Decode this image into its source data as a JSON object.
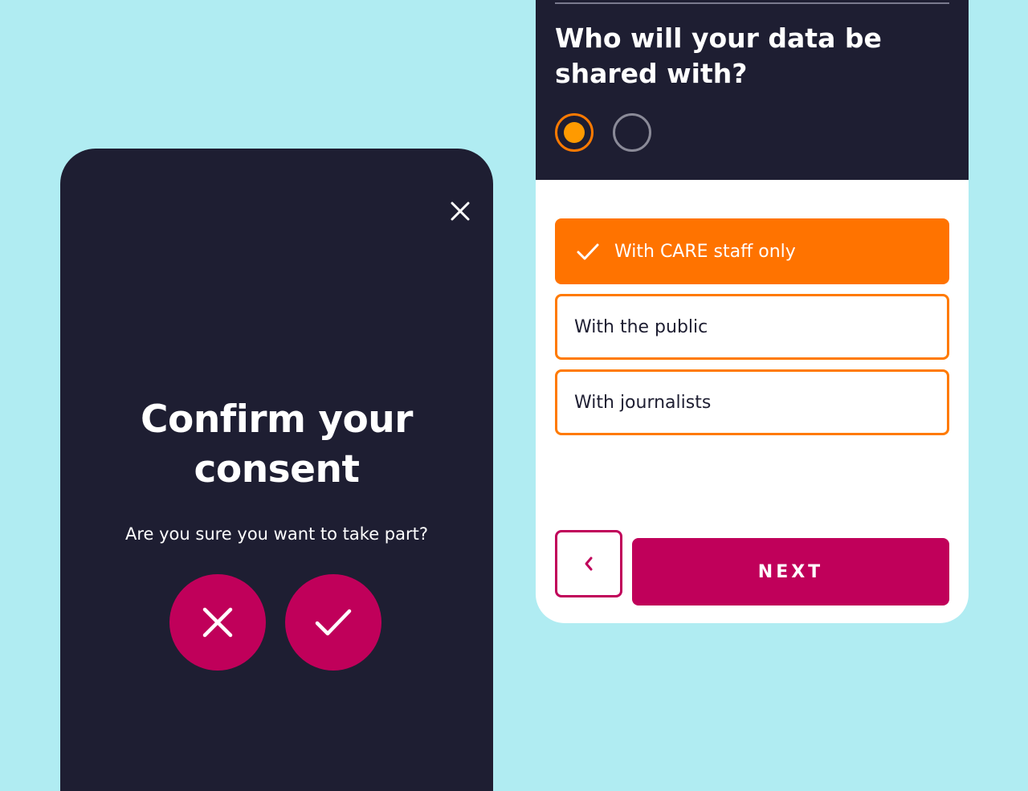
{
  "colors": {
    "background": "#b0ecf2",
    "panel_dark": "#1e1e32",
    "accent_orange": "#ff7300",
    "accent_magenta": "#c0005a"
  },
  "consent_modal": {
    "close_icon": "close-icon",
    "title": "Confirm your consent",
    "subtitle": "Are you sure you want to take part?",
    "decline_icon": "x-icon",
    "accept_icon": "checkmark-icon"
  },
  "question_screen": {
    "title": "Who will your data be shared with?",
    "progress": {
      "total_steps": 2,
      "current_step": 1
    },
    "options": [
      {
        "label": "With CARE staff only",
        "selected": true
      },
      {
        "label": "With the public",
        "selected": false
      },
      {
        "label": "With journalists",
        "selected": false
      }
    ],
    "back_icon": "chevron-left-icon",
    "next_label": "NEXT"
  }
}
